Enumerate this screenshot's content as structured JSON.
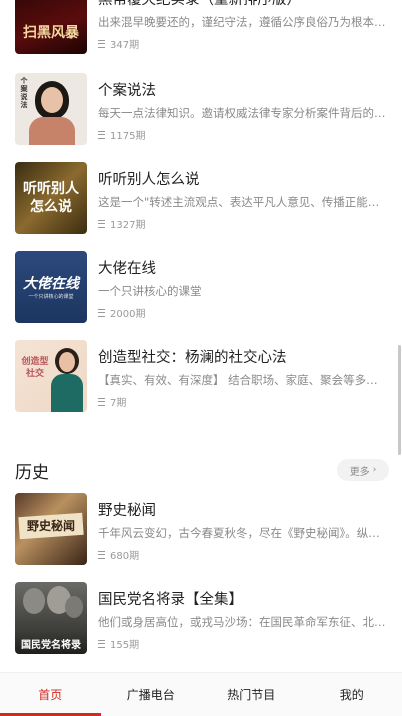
{
  "items_top": [
    {
      "title": "黑帮覆灭纪实录（重新排序版）",
      "desc": "出来混早晚要还的，谨纪守法，遵循公序良俗乃为根本…",
      "count": "347期",
      "thumb_text": "扫黑风暴",
      "thumb_small": "大案"
    },
    {
      "title": "个案说法",
      "desc": "每天一点法律知识。邀请权威法律专家分析案件背后的…",
      "count": "1175期",
      "thumb_text": "个案说法"
    },
    {
      "title": "听听别人怎么说",
      "desc": "这是一个\"转述主流观点、表达平凡人意见、传播正能…",
      "count": "1327期",
      "thumb_text": "听听别人怎么说"
    },
    {
      "title": "大佬在线",
      "desc": "一个只讲核心的课堂",
      "count": "2000期",
      "thumb_text": "大佬在线",
      "thumb_sub": "一个只讲核心的课堂"
    },
    {
      "title": "创造型社交：杨澜的社交心法",
      "desc": "【真实、有效、有深度】 结合职场、家庭、聚会等多个…",
      "count": "7期",
      "thumb_text": "创造型社交"
    }
  ],
  "history": {
    "title": "历史",
    "more_label": "更多",
    "items": [
      {
        "title": "野史秘闻",
        "desc": "千年风云变幻，古今春夏秋冬，尽在《野史秘闻》。纵…",
        "count": "680期",
        "thumb_text": "野史秘闻"
      },
      {
        "title": "国民党名将录【全集】",
        "desc": "他们或身居高位，或戎马沙场：在国民革命军东征、北…",
        "count": "155期",
        "thumb_text": "国民党名将录"
      }
    ]
  },
  "tabs": [
    {
      "label": "首页",
      "active": true
    },
    {
      "label": "广播电台",
      "active": false
    },
    {
      "label": "热门节目",
      "active": false
    },
    {
      "label": "我的",
      "active": false
    }
  ],
  "colors": {
    "accent": "#d12a1f"
  }
}
